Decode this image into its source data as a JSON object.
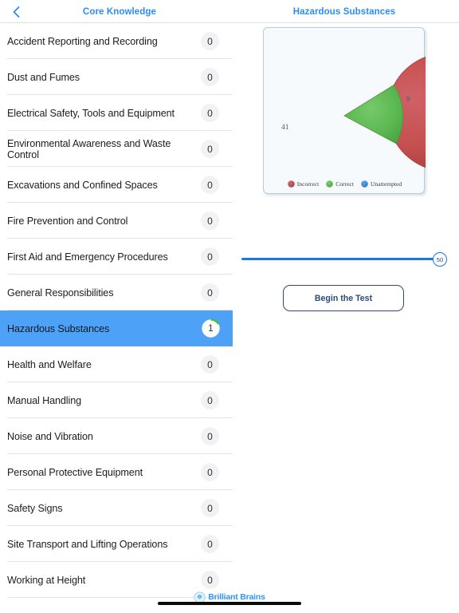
{
  "navbar": {
    "back_icon": "chevron-left-icon",
    "left_title": "Core Knowledge",
    "right_title": "Hazardous Substances",
    "accent_color": "#2b8cf5"
  },
  "topic_list": {
    "selected_index": 8,
    "items": [
      {
        "label": "Accident Reporting and Recording",
        "count": "0"
      },
      {
        "label": "Dust and Fumes",
        "count": "0"
      },
      {
        "label": "Electrical Safety, Tools and Equipment",
        "count": "0"
      },
      {
        "label": "Environmental Awareness and Waste Control",
        "count": "0"
      },
      {
        "label": "Excavations and Confined Spaces",
        "count": "0"
      },
      {
        "label": "Fire Prevention and Control",
        "count": "0"
      },
      {
        "label": "First Aid and Emergency Procedures",
        "count": "0"
      },
      {
        "label": "General Responsibilities",
        "count": "0"
      },
      {
        "label": "Hazardous Substances",
        "count": "1"
      },
      {
        "label": "Health and Welfare",
        "count": "0"
      },
      {
        "label": "Manual Handling",
        "count": "0"
      },
      {
        "label": "Noise and Vibration",
        "count": "0"
      },
      {
        "label": "Personal Protective Equipment",
        "count": "0"
      },
      {
        "label": "Safety Signs",
        "count": "0"
      },
      {
        "label": "Site Transport and Lifting Operations",
        "count": "0"
      },
      {
        "label": "Working at Height",
        "count": "0"
      }
    ],
    "selected_bg_color": "#4da2f8",
    "badge_bg_color": "#f2f2f4",
    "progress_arc_color": "#3cc23c"
  },
  "chart_data": {
    "type": "pie",
    "title": "",
    "categories": [
      "Incorrect",
      "Correct",
      "Unattempted"
    ],
    "values": [
      41,
      9,
      0
    ],
    "colors": [
      "#c0484d",
      "#57b44f",
      "#3a8fd8"
    ],
    "labels": [
      "41",
      "9"
    ],
    "legend": [
      "Incorrect",
      "Correct",
      "Unattempted"
    ],
    "legend_position": "bottom",
    "total": 50
  },
  "slider": {
    "value": "50",
    "min": 0,
    "max": 50,
    "fill_color": "#1579e8"
  },
  "begin_button": {
    "label": "Begin the Test",
    "color": "#2a4a78"
  },
  "footer": {
    "brand_name": "Brilliant Brains",
    "brand_color": "#2e97ef",
    "logo_icon": "brain-logo-icon"
  }
}
